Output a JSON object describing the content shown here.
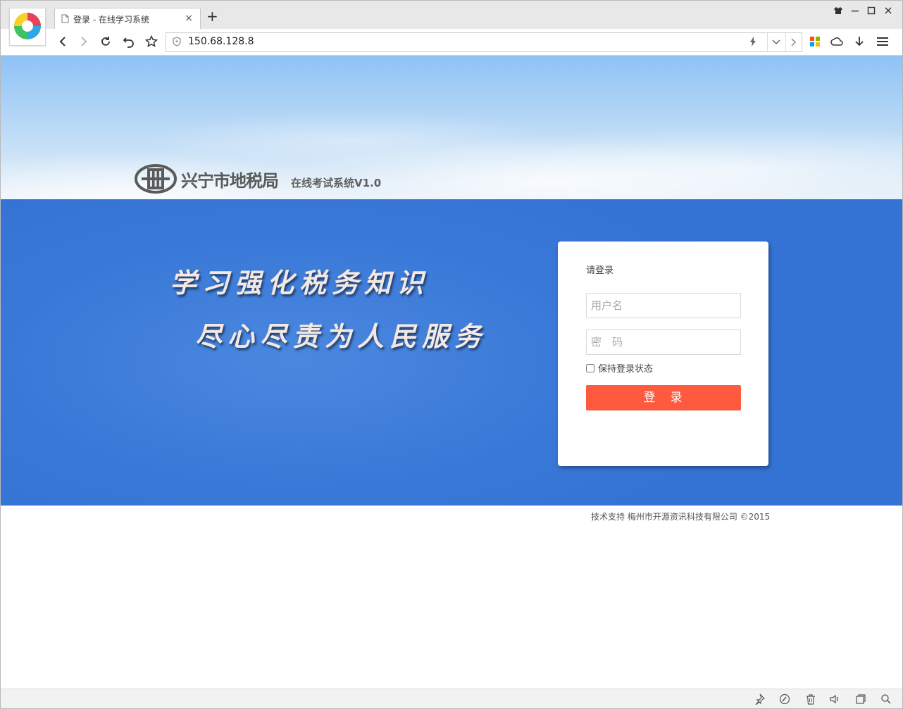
{
  "browser": {
    "tab_title": "登录 - 在线学习系统",
    "tab_close": "×",
    "new_tab": "+",
    "url": "150.68.128.8"
  },
  "header": {
    "org_name": "兴宁市地税局",
    "system_name": "在线考试系统V1.0"
  },
  "slogan": {
    "line1": "学习强化税务知识",
    "line2": "尽心尽责为人民服务"
  },
  "login": {
    "prompt": "请登录",
    "username_placeholder": "用户名",
    "password_placeholder": "密　码",
    "remember_label": "保持登录状态",
    "submit_label": "登　录"
  },
  "footer": {
    "text": "技术支持 梅州市开源资讯科技有限公司 ©2015"
  },
  "colors": {
    "band_blue": "#3a78d8",
    "login_button": "#fd5a40"
  }
}
